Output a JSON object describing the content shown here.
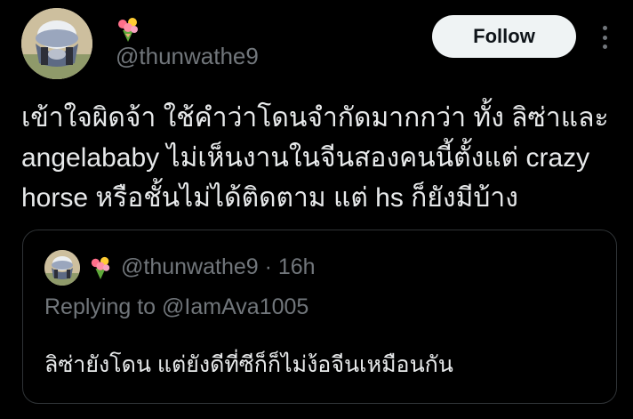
{
  "tweet": {
    "handle": "@thunwathe9",
    "display_name_emoji": "bouquet-emoji",
    "follow_label": "Follow",
    "text_lines": [
      "เข้าใจผิดจ้า ใช้คำว่าโดนจำกัดมากกว่า ทั้ง ลิซ่าและ",
      "angelababy ไม่เห็นงานในจีนสองคนนี้ตั้งแต่ crazy",
      "horse หรือชั้นไม่ได้ติดตาม แต่ hs ก็ยังมีบ้าง"
    ]
  },
  "quote": {
    "author_line": "@thunwathe9 · 16h",
    "replying_line": "Replying to @IamAva1005",
    "text": "ลิซ่ายังโดน แต่ยังดีที่ซีก็ก็ไม่ง้อจีนเหมือนกัน"
  },
  "colors": {
    "background": "#000000",
    "text_primary": "#e7e9ea",
    "text_secondary": "#71767b",
    "border": "#2f3336",
    "follow_bg": "#eff3f4"
  }
}
